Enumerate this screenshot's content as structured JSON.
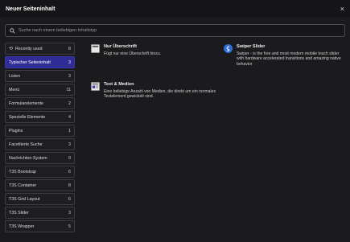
{
  "header": {
    "title": "Neuer Seiteninhalt",
    "close": "×"
  },
  "search": {
    "placeholder": "Suche nach einem beliebigen Inhaltstyp"
  },
  "sidebar": {
    "items": [
      {
        "label": "Recently used",
        "count": "8"
      },
      {
        "label": "Typischer Seiteninhalt",
        "count": "3"
      },
      {
        "label": "Listen",
        "count": "3"
      },
      {
        "label": "Menü",
        "count": "11"
      },
      {
        "label": "Formularelemente",
        "count": "2"
      },
      {
        "label": "Spezielle Elemente",
        "count": "4"
      },
      {
        "label": "Plugins",
        "count": "1"
      },
      {
        "label": "Facettierte Suche",
        "count": "3"
      },
      {
        "label": "Nachrichten-System",
        "count": "9"
      },
      {
        "label": "T3S Bootstrap",
        "count": "6"
      },
      {
        "label": "T3S Container",
        "count": "8"
      },
      {
        "label": "T3S Grid Layout",
        "count": "6"
      },
      {
        "label": "T3S Slider",
        "count": "3"
      },
      {
        "label": "T3S Wrapper",
        "count": "5"
      }
    ]
  },
  "cards": [
    {
      "name": "Nur Überschrift",
      "desc": "Fügt nur eine Überschrift hinzu."
    },
    {
      "name": "Swiper Slider",
      "desc": "Swiper - is the free and most modern mobile touch slider with hardware accelerated transitions and amazing native behavior"
    },
    {
      "name": "Text & Medien",
      "desc": "Eine beliebige Anzahl von Medien, die direkt um ein normales Textelement gewickelt sind."
    }
  ],
  "colors": {
    "active": "#2f2d95",
    "swiper": "#2f6fd6"
  },
  "icons": {
    "history": "history-icon",
    "search": "search-icon",
    "close": "close-icon"
  }
}
